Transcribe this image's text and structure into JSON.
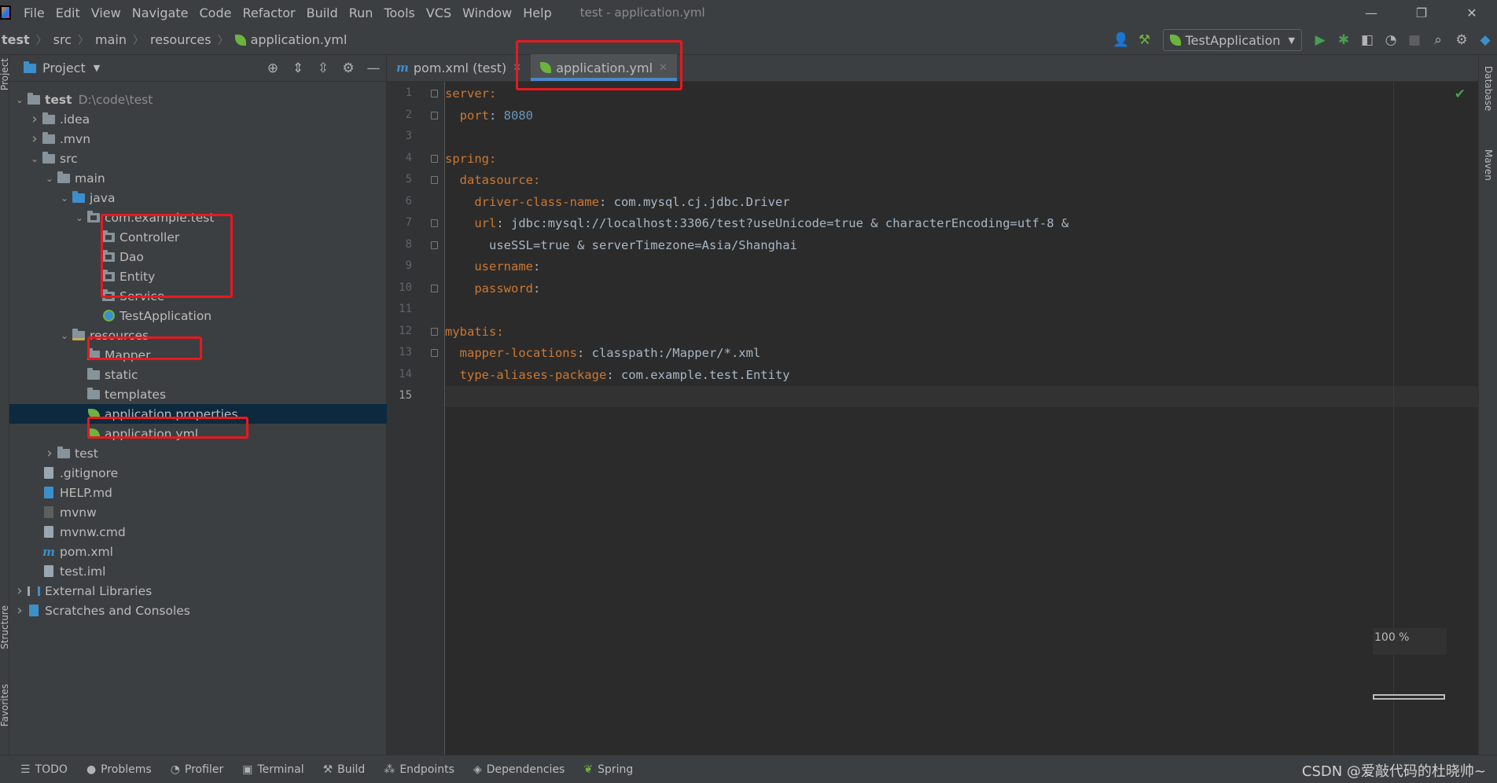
{
  "menubar": {
    "items": [
      "File",
      "Edit",
      "View",
      "Navigate",
      "Code",
      "Refactor",
      "Build",
      "Run",
      "Tools",
      "VCS",
      "Window",
      "Help"
    ],
    "title": "test - application.yml",
    "window_controls": [
      "—",
      "❐",
      "✕"
    ]
  },
  "navbar": {
    "breadcrumb": [
      "test",
      "src",
      "main",
      "resources",
      "application.yml"
    ],
    "run_config": "TestApplication"
  },
  "project_panel": {
    "title": "Project",
    "tree": [
      {
        "label": "test",
        "extra": "D:\\code\\test",
        "icon": "folder-icon",
        "depth": 0,
        "arrow": "down",
        "bold": true
      },
      {
        "label": ".idea",
        "icon": "folder-icon",
        "depth": 1,
        "arrow": "right"
      },
      {
        "label": ".mvn",
        "icon": "folder-icon",
        "depth": 1,
        "arrow": "right"
      },
      {
        "label": "src",
        "icon": "folder-icon",
        "depth": 1,
        "arrow": "down"
      },
      {
        "label": "main",
        "icon": "folder-icon",
        "depth": 2,
        "arrow": "down"
      },
      {
        "label": "java",
        "icon": "source-folder-icon",
        "depth": 3,
        "arrow": "down"
      },
      {
        "label": "com.example.test",
        "icon": "package-icon",
        "depth": 4,
        "arrow": "down"
      },
      {
        "label": "Controller",
        "icon": "package-icon",
        "depth": 5,
        "arrow": ""
      },
      {
        "label": "Dao",
        "icon": "package-icon",
        "depth": 5,
        "arrow": ""
      },
      {
        "label": "Entity",
        "icon": "package-icon",
        "depth": 5,
        "arrow": ""
      },
      {
        "label": "Service",
        "icon": "package-icon",
        "depth": 5,
        "arrow": ""
      },
      {
        "label": "TestApplication",
        "icon": "spring-class-icon",
        "depth": 5,
        "arrow": ""
      },
      {
        "label": "resources",
        "icon": "resources-folder-icon",
        "depth": 3,
        "arrow": "down"
      },
      {
        "label": "Mapper",
        "icon": "folder-icon",
        "depth": 4,
        "arrow": ""
      },
      {
        "label": "static",
        "icon": "folder-icon",
        "depth": 4,
        "arrow": ""
      },
      {
        "label": "templates",
        "icon": "folder-icon",
        "depth": 4,
        "arrow": ""
      },
      {
        "label": "application.properties",
        "icon": "spring-leaf-icon",
        "depth": 4,
        "arrow": "",
        "selected": true
      },
      {
        "label": "application.yml",
        "icon": "spring-leaf-icon",
        "depth": 4,
        "arrow": ""
      },
      {
        "label": "test",
        "icon": "folder-icon",
        "depth": 2,
        "arrow": "right"
      },
      {
        "label": ".gitignore",
        "icon": "file-icon",
        "depth": 1,
        "arrow": ""
      },
      {
        "label": "HELP.md",
        "icon": "markdown-icon",
        "depth": 1,
        "arrow": ""
      },
      {
        "label": "mvnw",
        "icon": "terminal-file-icon",
        "depth": 1,
        "arrow": ""
      },
      {
        "label": "mvnw.cmd",
        "icon": "file-icon",
        "depth": 1,
        "arrow": ""
      },
      {
        "label": "pom.xml",
        "icon": "maven-icon",
        "depth": 1,
        "arrow": ""
      },
      {
        "label": "test.iml",
        "icon": "file-icon",
        "depth": 1,
        "arrow": ""
      },
      {
        "label": "External Libraries",
        "icon": "library-icon",
        "depth": 0,
        "arrow": "right"
      },
      {
        "label": "Scratches and Consoles",
        "icon": "scratches-icon",
        "depth": 0,
        "arrow": "right"
      }
    ]
  },
  "editor": {
    "tabs": [
      {
        "label": "pom.xml (test)",
        "icon": "maven-icon",
        "active": false
      },
      {
        "label": "application.yml",
        "icon": "spring-leaf-icon",
        "active": true
      }
    ],
    "lines": [
      [
        [
          "k",
          "server:"
        ]
      ],
      [
        [
          "k",
          "  port"
        ],
        [
          "v",
          ": "
        ],
        [
          "num",
          "8080"
        ]
      ],
      [],
      [
        [
          "k",
          "spring:"
        ]
      ],
      [
        [
          "k",
          "  datasource:"
        ]
      ],
      [
        [
          "k",
          "    driver-class-name"
        ],
        [
          "v",
          ": "
        ],
        [
          "cls",
          "com.mysql.cj.jdbc.Driver"
        ]
      ],
      [
        [
          "k",
          "    url"
        ],
        [
          "v",
          ": jdbc:mysql://localhost:3306/test?useUnicode=true & characterEncoding=utf-8 &"
        ]
      ],
      [
        [
          "v",
          "      useSSL=true & serverTimezone=Asia/Shanghai"
        ]
      ],
      [
        [
          "k",
          "    username"
        ],
        [
          "v",
          ":"
        ]
      ],
      [
        [
          "k",
          "    password"
        ],
        [
          "v",
          ":"
        ]
      ],
      [],
      [
        [
          "k",
          "mybatis:"
        ]
      ],
      [
        [
          "k",
          "  mapper-locations"
        ],
        [
          "v",
          ": classpath:/Mapper/*.xml"
        ]
      ],
      [
        [
          "k",
          "  type-aliases-package"
        ],
        [
          "v",
          ": com.example.test.Entity"
        ]
      ],
      []
    ],
    "line_numbers": [
      "1",
      "2",
      "3",
      "4",
      "5",
      "6",
      "7",
      "8",
      "9",
      "10",
      "11",
      "12",
      "13",
      "14",
      "15"
    ],
    "current_line": 15,
    "zoom": "100 %"
  },
  "side_stripes": {
    "left": [
      "Project",
      "Structure",
      "Favorites"
    ],
    "right": [
      "Database",
      "Maven"
    ]
  },
  "bottombar": {
    "items": [
      {
        "label": "TODO",
        "icon": "todo-icon"
      },
      {
        "label": "Problems",
        "icon": "problems-icon"
      },
      {
        "label": "Profiler",
        "icon": "profiler-icon"
      },
      {
        "label": "Terminal",
        "icon": "terminal-icon"
      },
      {
        "label": "Build",
        "icon": "build-icon"
      },
      {
        "label": "Endpoints",
        "icon": "endpoints-icon"
      },
      {
        "label": "Dependencies",
        "icon": "dependencies-icon"
      },
      {
        "label": "Spring",
        "icon": "spring-icon"
      }
    ],
    "watermark": "CSDN @爱敲代码的杜晓帅~"
  },
  "colors": {
    "highlight_box": "#e8191f",
    "yaml_key": "#cc7832",
    "number": "#6897bb",
    "selection": "#0d293e"
  }
}
